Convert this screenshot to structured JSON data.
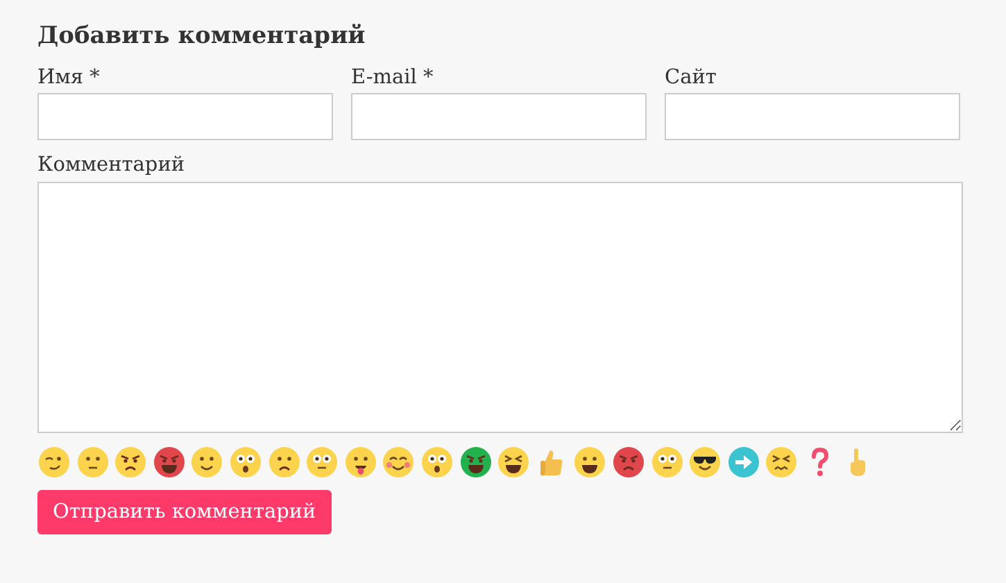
{
  "title": "Добавить комментарий",
  "fields": [
    {
      "label": "Имя *"
    },
    {
      "label": "E-mail *"
    },
    {
      "label": "Сайт"
    }
  ],
  "comment": {
    "label": "Комментарий"
  },
  "submit": "Отправить комментарий"
}
